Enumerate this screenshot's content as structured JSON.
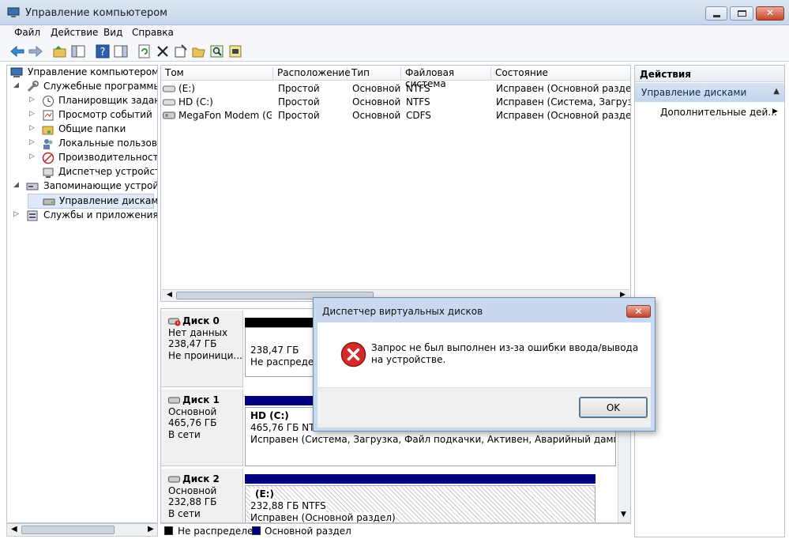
{
  "window": {
    "title": "Управление компьютером"
  },
  "menu": [
    "Файл",
    "Действие",
    "Вид",
    "Справка"
  ],
  "tree": {
    "root": "Управление компьютером (л",
    "items": [
      "Служебные программы",
      "Планировщик заданий",
      "Просмотр событий",
      "Общие папки",
      "Локальные пользовате",
      "Производительность",
      "Диспетчер устройств",
      "Запоминающие устройст",
      "Управление дисками",
      "Службы и приложения"
    ]
  },
  "volumes": {
    "columns": [
      "Том",
      "Расположение",
      "Тип",
      "Файловая система",
      "Состояние"
    ],
    "rows": [
      [
        "(E:)",
        "Простой",
        "Основной",
        "NTFS",
        "Исправен (Основной раздел)"
      ],
      [
        "HD (C:)",
        "Простой",
        "Основной",
        "NTFS",
        "Исправен (Система, Загрузка, Ф"
      ],
      [
        "MegaFon Modem (G:)",
        "Простой",
        "Основной",
        "CDFS",
        "Исправен (Основной раздел)"
      ]
    ]
  },
  "disks": [
    {
      "name": "Диск 0",
      "l1": "Нет данных",
      "l2": "238,47 ГБ",
      "l3": "Не проиници...",
      "p1": "238,47 ГБ",
      "p2": "Не распределе"
    },
    {
      "name": "Диск 1",
      "l1": "Основной",
      "l2": "465,76 ГБ",
      "l3": "В сети",
      "p0": "HD  (C:)",
      "p1": "465,76 ГБ NTFS",
      "p2": "Исправен (Система, Загрузка, Файл подкачки, Активен, Аварийный дамп памяти, О"
    },
    {
      "name": "Диск 2",
      "l1": "Основной",
      "l2": "232,88 ГБ",
      "l3": "В сети",
      "p0": "(E:)",
      "p1": "232,88 ГБ NTFS",
      "p2": "Исправен (Основной раздел)"
    }
  ],
  "legend": [
    "Не распределен",
    "Основной раздел"
  ],
  "actions": {
    "title": "Действия",
    "section": "Управление дисками",
    "more": "Дополнительные дей..."
  },
  "dialog": {
    "title": "Диспетчер виртуальных дисков",
    "message": "Запрос не был выполнен из-за ошибки ввода/вывода на устройстве.",
    "ok": "OK"
  },
  "colors": {
    "unallocated": "#000000",
    "primary": "#00007f"
  }
}
